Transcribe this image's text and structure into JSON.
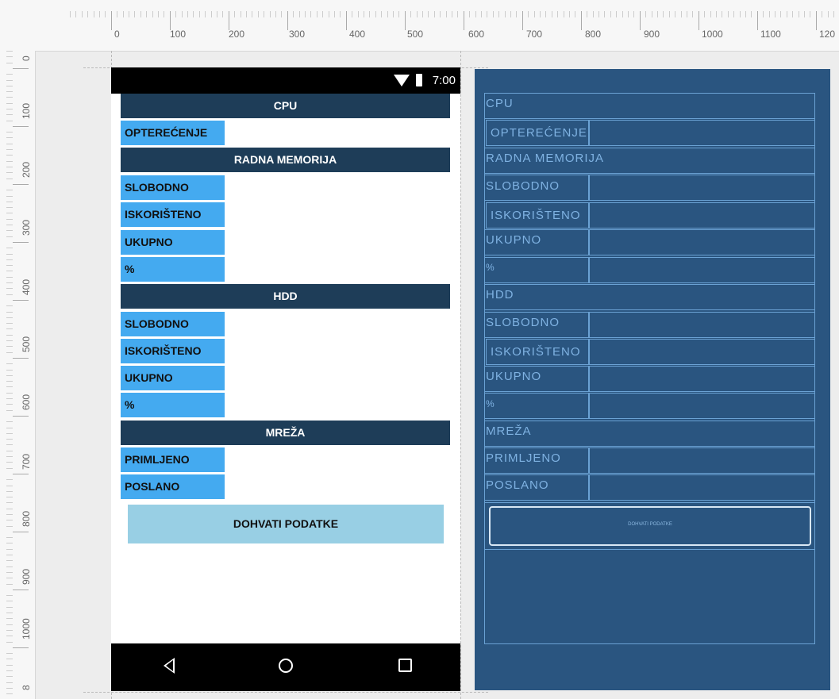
{
  "ruler": {
    "h_labels": [
      "0",
      "100",
      "200",
      "300",
      "400",
      "500",
      "600",
      "700",
      "800",
      "900",
      "1000",
      "1100",
      "120"
    ],
    "v_labels": [
      "0",
      "100",
      "200",
      "300",
      "400",
      "500",
      "600",
      "700",
      "800",
      "900",
      "1000",
      "8"
    ]
  },
  "statusbar": {
    "time": "7:00"
  },
  "app": {
    "cpu_header": "CPU",
    "cpu_load_label": "OPTEREĆENJE",
    "ram_header": "RADNA MEMORIJA",
    "ram_free_label": "SLOBODNO",
    "ram_used_label": "ISKORIŠTENO",
    "ram_total_label": "UKUPNO",
    "ram_percent_label": "%",
    "hdd_header": "HDD",
    "hdd_free_label": "SLOBODNO",
    "hdd_used_label": "ISKORIŠTENO",
    "hdd_total_label": "UKUPNO",
    "hdd_percent_label": "%",
    "net_header": "MREŽA",
    "net_received_label": "PRIMLJENO",
    "net_sent_label": "POSLANO",
    "fetch_button": "DOHVATI PODATKE"
  },
  "blueprint": {
    "cpu": "CPU",
    "load": "OPTEREĆENJE",
    "ram": "RADNA MEMORIJA",
    "free1": "SLOBODNO",
    "used1": "ISKORIŠTENO",
    "total1": "UKUPNO",
    "pct1": "%",
    "hdd": "HDD",
    "free2": "SLOBODNO",
    "used2": "ISKORIŠTENO",
    "total2": "UKUPNO",
    "pct2": "%",
    "net": "MREŽA",
    "recv": "PRIMLJENO",
    "sent": "POSLANO",
    "button": "DOHVATI PODATKE"
  },
  "colors": {
    "header_bg": "#1e3d58",
    "label_bg": "#44aaf0",
    "button_bg": "#98cfe4",
    "blueprint_bg": "#2a5580"
  }
}
